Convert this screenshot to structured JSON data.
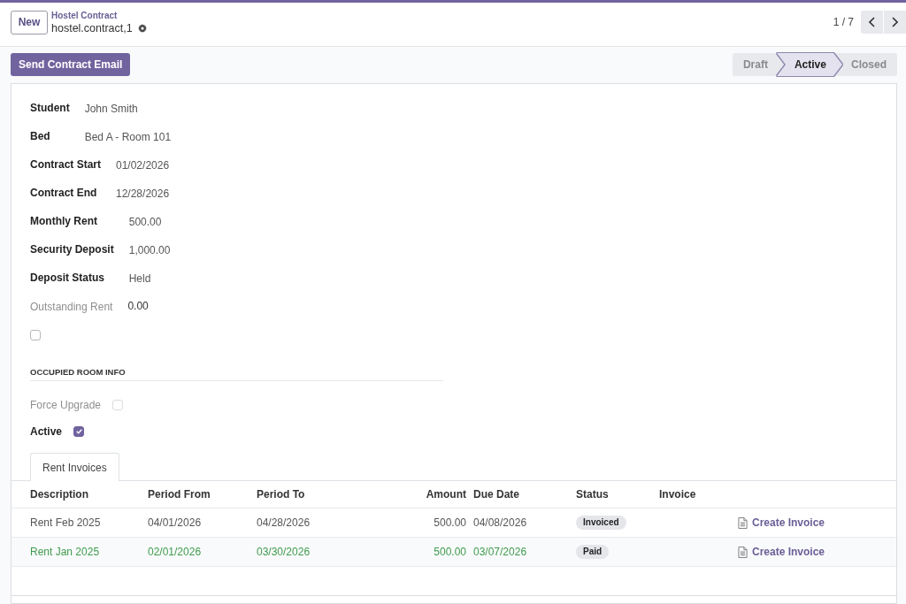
{
  "control_panel": {
    "new_button": "New",
    "breadcrumb": "Hostel Contract",
    "record_name": "hostel.contract,1",
    "pager": "1 / 7"
  },
  "header": {
    "action_buttons": [
      "Send Contract Email"
    ],
    "statusbar": [
      {
        "label": "Draft",
        "selected": false
      },
      {
        "label": "Active",
        "selected": true
      },
      {
        "label": "Closed",
        "selected": false
      }
    ]
  },
  "field_groups": [
    [
      {
        "kind": "text",
        "label": "Student",
        "value": "John Smith",
        "readonly": false
      },
      {
        "kind": "text",
        "label": "Bed",
        "value": "Bed A - Room 101",
        "readonly": false
      }
    ],
    [
      {
        "kind": "text",
        "label": "Contract Start",
        "value": "01/02/2026",
        "readonly": false
      },
      {
        "kind": "text",
        "label": "Contract End",
        "value": "12/28/2026",
        "readonly": false
      }
    ],
    [
      {
        "kind": "text",
        "label": "Monthly Rent",
        "value": "500.00",
        "readonly": false
      },
      {
        "kind": "text",
        "label": "Security Deposit",
        "value": "1,000.00",
        "readonly": false
      },
      {
        "kind": "text",
        "label": "Deposit Status",
        "value": "Held",
        "readonly": false
      }
    ],
    [
      {
        "kind": "text",
        "label": "Outstanding Rent",
        "value": "0.00",
        "readonly": true
      },
      {
        "kind": "checkbox",
        "checked": false,
        "readonly": false
      }
    ]
  ],
  "section": {
    "title": "OCCUPIED ROOM INFO",
    "fields": [
      {
        "kind": "checkbox",
        "label": "Force Upgrade",
        "checked": false,
        "readonly": true
      },
      {
        "kind": "checkbox",
        "label": "Active",
        "checked": true,
        "readonly": false
      }
    ]
  },
  "notebook": {
    "tabs": [
      {
        "label": "Rent Invoices",
        "selected": true
      }
    ],
    "table": {
      "columns": [
        "Description",
        "Period From",
        "Period To",
        "Amount",
        "Due Date",
        "Status",
        "Invoice"
      ],
      "rows": [
        {
          "success": false,
          "description": "Rent Feb 2025",
          "period_from": "04/01/2026",
          "period_to": "04/28/2026",
          "amount": "500.00",
          "due_date": "04/08/2026",
          "status": "Invoiced",
          "action": "Create Invoice"
        },
        {
          "success": true,
          "description": "Rent Jan 2025",
          "period_from": "02/01/2026",
          "period_to": "03/30/2026",
          "amount": "500.00",
          "due_date": "03/07/2026",
          "status": "Paid",
          "action": "Create Invoice"
        }
      ]
    }
  }
}
